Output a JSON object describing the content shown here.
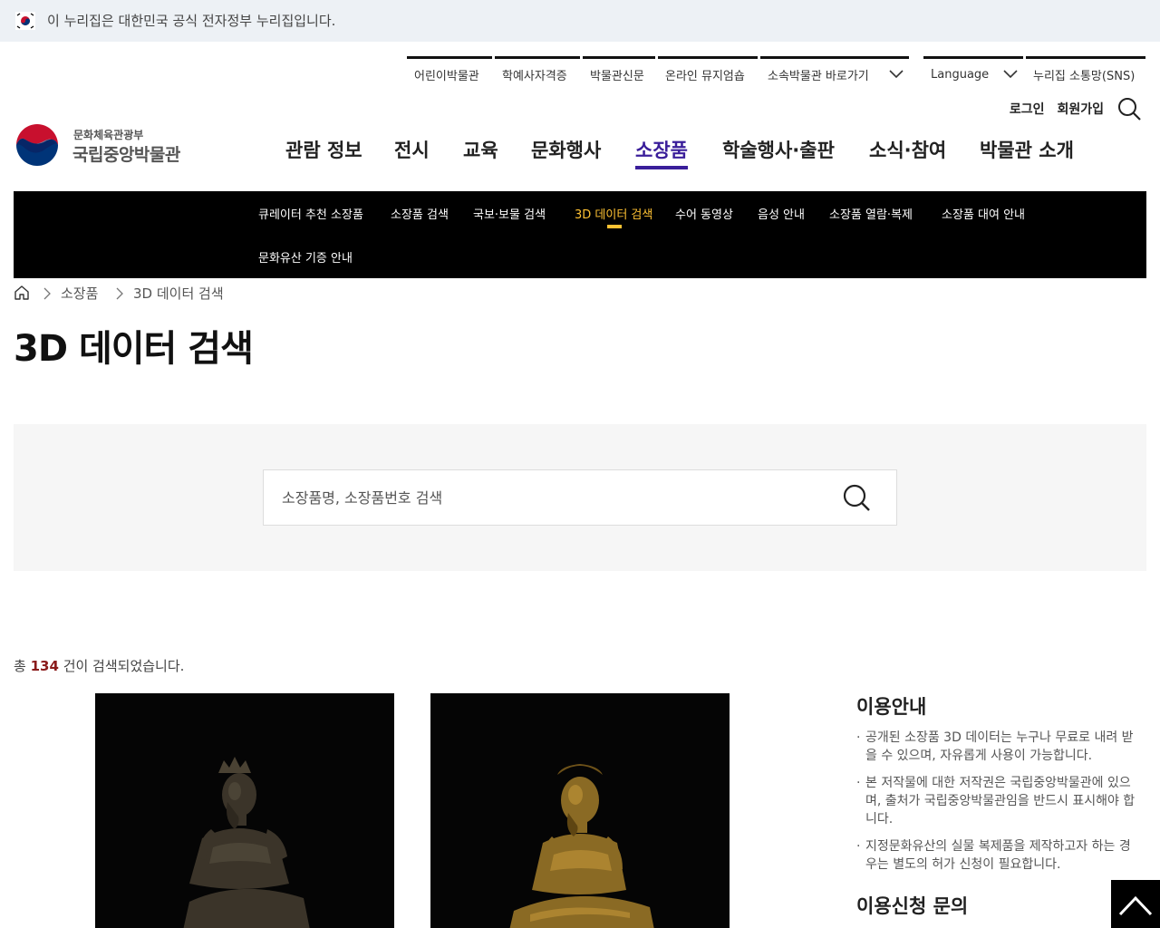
{
  "gov_banner": {
    "text": "이 누리집은 대한민국 공식 전자정부 누리집입니다.",
    "flag_icon": "korea-flag-icon"
  },
  "utility_nav": [
    {
      "label": "어린이박물관"
    },
    {
      "label": "학예사자격증"
    },
    {
      "label": "박물관신문"
    },
    {
      "label": "온라인 뮤지엄숍"
    },
    {
      "label": "소속박물관 바로가기"
    },
    {
      "label": "Language"
    },
    {
      "label": "누리집 소통망(SNS)"
    }
  ],
  "user_links": {
    "login": "로그인",
    "signup": "회원가입"
  },
  "logo": {
    "sub": "문화체육관광부",
    "main": "국립중앙박물관"
  },
  "gnb": [
    "관람 정보",
    "전시",
    "교육",
    "문화행사",
    "소장품",
    "학술행사·출판",
    "소식·참여",
    "박물관 소개"
  ],
  "gnb_active": "소장품",
  "subnav": [
    "큐레이터 추천 소장품",
    "소장품 검색",
    "국보·보물 검색",
    "3D 데이터 검색",
    "수어 동영상",
    "음성 안내",
    "소장품 열람·복제",
    "소장품 대여 안내",
    "문화유산 기증 안내"
  ],
  "subnav_active": "3D 데이터 검색",
  "breadcrumb": [
    "소장품",
    "3D 데이터 검색"
  ],
  "page_title": "3D 데이터 검색",
  "search": {
    "placeholder": "소장품명, 소장품번호 검색"
  },
  "result": {
    "prefix": "총",
    "count": "134",
    "suffix": "건이 검색되었습니다."
  },
  "cards": [
    {
      "image": "bronze-pensive-bodhisattva-crowned"
    },
    {
      "image": "gilt-bronze-pensive-bodhisattva"
    }
  ],
  "guide": {
    "title": "이용안내",
    "items": [
      "공개된 소장품 3D 데이터는 누구나 무료로 내려 받을 수 있으며, 자유롭게 사용이 가능합니다.",
      "본 저작물에 대한 저작권은 국립중앙박물관에 있으며, 출처가 국립중앙박물관임을 반드시 표시해야 합니다.",
      "지정문화유산의 실물 복제품을 제작하고자 하는 경우는 별도의 허가 신청이 필요합니다."
    ],
    "next_title": "이용신청 문의"
  },
  "colors": {
    "accent_purple": "#3a1e9a",
    "subnav_active": "#ffc233",
    "count_red": "#8a1a1a"
  }
}
